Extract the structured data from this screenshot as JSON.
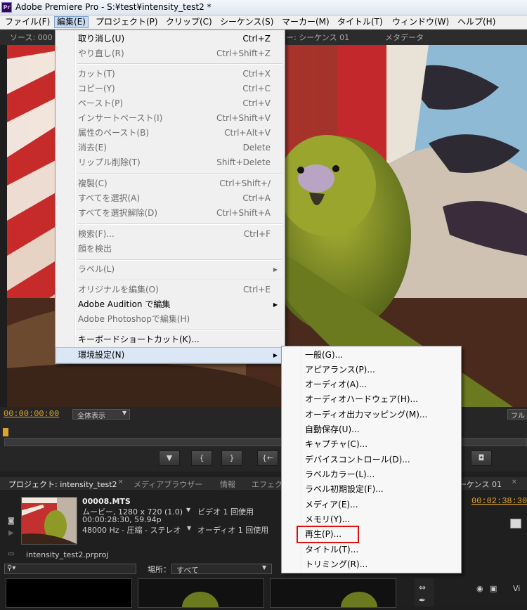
{
  "window": {
    "app_icon_text": "Pr",
    "title": "Adobe Premiere Pro - S:¥test¥intensity_test2 *"
  },
  "menubar": [
    "ファイル(F)",
    "編集(E)",
    "プロジェクト(P)",
    "クリップ(C)",
    "シーケンス(S)",
    "マーカー(M)",
    "タイトル(T)",
    "ウィンドウ(W)",
    "ヘルプ(H)"
  ],
  "panel_tabs": {
    "source": "ソース: 000",
    "program": "ー: シーケンス 01",
    "metadata": "メタデータ"
  },
  "source_monitor": {
    "timecode": "00:00:00:00",
    "zoom": "全体表示",
    "full_button": "フル"
  },
  "edit_menu": {
    "items": [
      {
        "label": "取り消し(U)",
        "shortcut": "Ctrl+Z",
        "enabled": true
      },
      {
        "label": "やり直し(R)",
        "shortcut": "Ctrl+Shift+Z",
        "enabled": false
      },
      {
        "label": "カット(T)",
        "shortcut": "Ctrl+X",
        "enabled": false
      },
      {
        "label": "コピー(Y)",
        "shortcut": "Ctrl+C",
        "enabled": false
      },
      {
        "label": "ペースト(P)",
        "shortcut": "Ctrl+V",
        "enabled": false
      },
      {
        "label": "インサートペースト(I)",
        "shortcut": "Ctrl+Shift+V",
        "enabled": false
      },
      {
        "label": "属性のペースト(B)",
        "shortcut": "Ctrl+Alt+V",
        "enabled": false
      },
      {
        "label": "消去(E)",
        "shortcut": "Delete",
        "enabled": false
      },
      {
        "label": "リップル削除(T)",
        "shortcut": "Shift+Delete",
        "enabled": false
      },
      {
        "label": "複製(C)",
        "shortcut": "Ctrl+Shift+/",
        "enabled": false
      },
      {
        "label": "すべてを選択(A)",
        "shortcut": "Ctrl+A",
        "enabled": false
      },
      {
        "label": "すべてを選択解除(D)",
        "shortcut": "Ctrl+Shift+A",
        "enabled": false
      },
      {
        "label": "検索(F)...",
        "shortcut": "Ctrl+F",
        "enabled": false
      },
      {
        "label": "顔を検出",
        "shortcut": "",
        "enabled": false
      },
      {
        "label": "ラベル(L)",
        "shortcut": "",
        "enabled": false
      },
      {
        "label": "オリジナルを編集(O)",
        "shortcut": "Ctrl+E",
        "enabled": false
      },
      {
        "label": "Adobe Audition で編集",
        "shortcut": "",
        "enabled": true
      },
      {
        "label": "Adobe Photoshopで編集(H)",
        "shortcut": "",
        "enabled": false
      },
      {
        "label": "キーボードショートカット(K)...",
        "shortcut": "",
        "enabled": true
      },
      {
        "label": "環境設定(N)",
        "shortcut": "",
        "enabled": true
      }
    ]
  },
  "preferences_submenu": {
    "items": [
      "一般(G)...",
      "アピアランス(P)...",
      "オーディオ(A)...",
      "オーディオハードウェア(H)...",
      "オーディオ出力マッピング(M)...",
      "自動保存(U)...",
      "キャプチャ(C)...",
      "デバイスコントロール(D)...",
      "ラベルカラー(L)...",
      "ラベル初期設定(F)...",
      "メディア(E)...",
      "メモリ(Y)...",
      "再生(P)...",
      "タイトル(T)...",
      "トリミング(R)..."
    ]
  },
  "project_panel": {
    "tabs": [
      "プロジェクト: intensity_test2",
      "メディアブラウザー",
      "情報",
      "エフェク"
    ],
    "clip_name": "00008.MTS",
    "clip_line1": "ムービー, 1280 x 720 (1.0)",
    "clip_video_usage": "ビデオ 1 回使用",
    "clip_line2": "00:00:28:30, 59.94p",
    "clip_line3": "48000 Hz - 圧縮 - ステレオ",
    "clip_audio_usage": "オーディオ 1 回使用",
    "project_file": "intensity_test2.prproj",
    "location_label": "場所：",
    "location_value": "すべて"
  },
  "sequence_panel": {
    "tab": "ーケンス 01",
    "timecode": "00:02:38:30",
    "track_label": "Vi"
  }
}
